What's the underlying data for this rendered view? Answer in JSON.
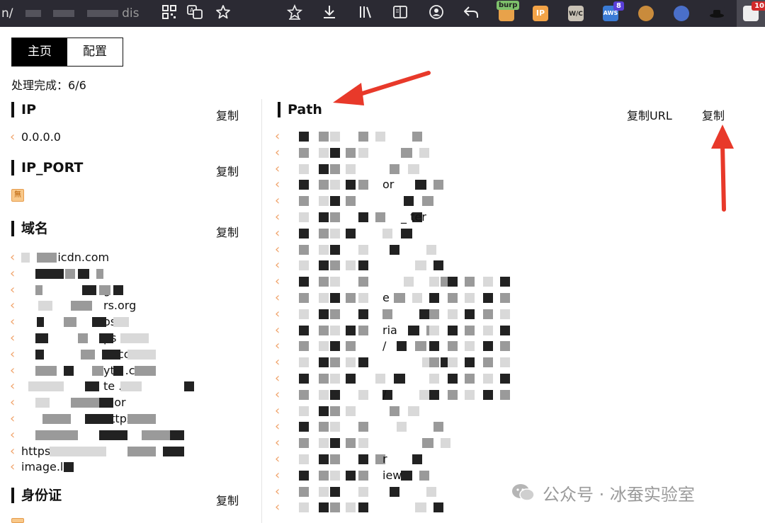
{
  "browser": {
    "url_fragment": "n/",
    "url_tail": "dis",
    "toolbar_icons": [
      "qr-code-icon",
      "translate-icon",
      "star-icon",
      "star-check-icon",
      "download-icon",
      "library-icon",
      "reader-view-icon",
      "account-icon",
      "undo-icon"
    ],
    "extensions": [
      {
        "name": "burp",
        "label": "burp"
      },
      {
        "name": "ip-extension",
        "label": "IP"
      },
      {
        "name": "wappalyzer",
        "label": "W/C"
      },
      {
        "name": "aws-extension",
        "label": "AWS",
        "badge": "8"
      },
      {
        "name": "cookie-icon",
        "label": ""
      },
      {
        "name": "globe-extension",
        "label": ""
      },
      {
        "name": "hat-extension",
        "label": ""
      },
      {
        "name": "findsomething-extension",
        "label": "",
        "badge": "10"
      }
    ]
  },
  "tabs": [
    {
      "label": "主页",
      "active": true
    },
    {
      "label": "配置",
      "active": false
    }
  ],
  "status_text": "处理完成：6/6",
  "left": {
    "sections": [
      {
        "title": "IP",
        "copy_label": "复制",
        "items": [
          "0.0.0.0"
        ]
      },
      {
        "title": "IP_PORT",
        "copy_label": "复制",
        "items": []
      },
      {
        "title": "域名",
        "copy_label": "复制",
        "items": [
          ".alicdn.com",
          "",
          "g",
          "rs.org",
          "os",
          "ps .com",
          "rs.com",
          "yte .com",
          "te .m",
          "h or",
          "https:// ",
          "h n",
          "https://w /",
          "image.lin"
        ]
      },
      {
        "title": "身份证",
        "copy_label": "复制",
        "items": []
      }
    ]
  },
  "right": {
    "title": "Path",
    "copy_url_label": "复制URL",
    "copy_label": "复制",
    "item_fragments": [
      "or",
      "_ ter",
      "e",
      "ria",
      "/",
      "/",
      "iew",
      "r"
    ]
  },
  "watermark": {
    "text": "公众号 · 冰蚕实验室"
  },
  "colors": {
    "accent_chevron": "#f0a36a",
    "annotation_arrow": "#e8392a",
    "toolbar_bg": "#2b2a33"
  }
}
